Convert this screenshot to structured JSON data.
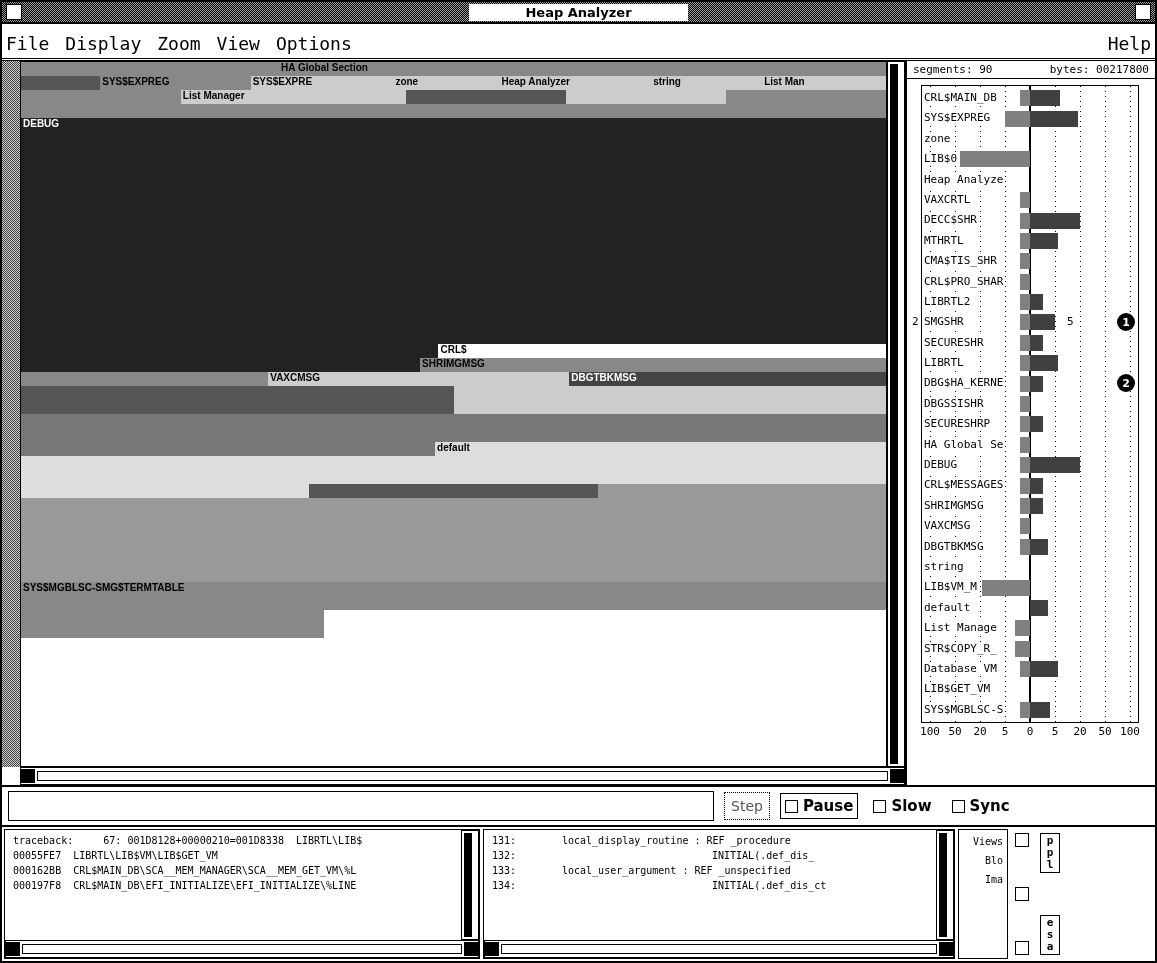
{
  "window": {
    "title": "Heap Analyzer"
  },
  "menu": {
    "items": [
      "File",
      "Display",
      "Zoom",
      "View",
      "Options"
    ],
    "help": "Help"
  },
  "memory_map": {
    "rows": [
      {
        "kind": "strip",
        "segments": [
          {
            "color": "#888888"
          },
          {
            "color": "#888888",
            "label": "HA Global Section"
          },
          {
            "color": "#888888"
          }
        ]
      },
      {
        "kind": "strip",
        "segments": [
          {
            "color": "#555555"
          },
          {
            "color": "#888888",
            "label": "SYS$EXPREG"
          },
          {
            "color": "#cccccc",
            "label": "SYS$EXPRE"
          },
          {
            "color": "#cccccc",
            "label": "zone"
          },
          {
            "color": "#cccccc",
            "label": "Heap Analyzer"
          },
          {
            "color": "#cccccc",
            "label": "string"
          },
          {
            "color": "#cccccc",
            "label": "List Man"
          }
        ]
      },
      {
        "kind": "strip",
        "segments": [
          {
            "color": "#888888"
          },
          {
            "color": "#cccccc",
            "label": "List Manager"
          },
          {
            "color": "#555555"
          },
          {
            "color": "#cccccc"
          },
          {
            "color": "#888888"
          }
        ]
      },
      {
        "kind": "strip",
        "segments": [
          {
            "color": "#888888"
          }
        ]
      },
      {
        "kind": "tall",
        "segments": [
          {
            "color": "#222222",
            "label": "DEBUG"
          }
        ]
      },
      {
        "kind": "strip",
        "segments": [
          {
            "color": "#222222"
          },
          {
            "color": "#ffffff",
            "label": "CRL$"
          }
        ]
      },
      {
        "kind": "strip",
        "segments": [
          {
            "color": "#222222"
          },
          {
            "color": "#888888",
            "label": "SHRIMGMSG"
          }
        ]
      },
      {
        "kind": "strip",
        "segments": [
          {
            "color": "#888888"
          },
          {
            "color": "#cccccc",
            "label": "VAXCMSG"
          },
          {
            "color": "#444444",
            "label": "DBGTBKMSG"
          }
        ]
      },
      {
        "kind": "band",
        "segments": [
          {
            "color": "#555555"
          },
          {
            "color": "#cccccc"
          }
        ]
      },
      {
        "kind": "band",
        "segments": [
          {
            "color": "#777777"
          }
        ]
      },
      {
        "kind": "strip",
        "segments": [
          {
            "color": "#777777"
          },
          {
            "color": "#dddddd",
            "label": "default"
          }
        ]
      },
      {
        "kind": "band",
        "segments": [
          {
            "color": "#dddddd"
          }
        ]
      },
      {
        "kind": "strip",
        "segments": [
          {
            "color": "#dddddd"
          },
          {
            "color": "#555555"
          },
          {
            "color": "#999999"
          }
        ]
      },
      {
        "kind": "block",
        "segments": [
          {
            "color": "#999999"
          }
        ]
      },
      {
        "kind": "band",
        "segments": [
          {
            "color": "#888888",
            "label": "SYS$MGBLSC-SMG$TERMTABLE"
          }
        ]
      },
      {
        "kind": "short",
        "segments": [
          {
            "color": "#888888"
          }
        ]
      }
    ]
  },
  "histogram": {
    "segments": "segments: 90",
    "bytes": "bytes: 00217800",
    "rows": [
      {
        "name": "CRL$MAIN_DB"
      },
      {
        "name": "SYS$EXPREG"
      },
      {
        "name": "zone"
      },
      {
        "name": "LIB$0"
      },
      {
        "name": "Heap Analyze"
      },
      {
        "name": "VAXCRTL"
      },
      {
        "name": "DECC$SHR"
      },
      {
        "name": "MTHRTL"
      },
      {
        "name": "CMA$TIS_SHR"
      },
      {
        "name": "CRL$PRO_SHAR"
      },
      {
        "name": "LIBRTL2"
      },
      {
        "name": "SMGSHR",
        "left_note": "2",
        "right_note": "5",
        "callout": "1"
      },
      {
        "name": "SECURESHR"
      },
      {
        "name": "LIBRTL"
      },
      {
        "name": "DBG$HA_KERNE",
        "callout": "2"
      },
      {
        "name": "DBGSSISHR"
      },
      {
        "name": "SECURESHRP"
      },
      {
        "name": "HA Global Se"
      },
      {
        "name": "DEBUG"
      },
      {
        "name": "CRL$MESSAGES"
      },
      {
        "name": "SHRIMGMSG"
      },
      {
        "name": "VAXCMSG"
      },
      {
        "name": "DBGTBKMSG"
      },
      {
        "name": "string"
      },
      {
        "name": "LIB$VM_M"
      },
      {
        "name": "default"
      },
      {
        "name": "List Manage"
      },
      {
        "name": "STR$COPY_R_"
      },
      {
        "name": "Database VM"
      },
      {
        "name": "LIB$GET_VM"
      },
      {
        "name": "SYS$MGBLSC-S"
      }
    ],
    "axis_labels": [
      "100",
      "50",
      "20",
      "5",
      "0",
      "5",
      "20",
      "50",
      "100"
    ]
  },
  "controls": {
    "step": {
      "label": "Step",
      "disabled": true
    },
    "toggles": [
      {
        "label": "Pause",
        "checked": false,
        "boxed": true
      },
      {
        "label": "Slow",
        "checked": false,
        "boxed": false
      },
      {
        "label": "Sync",
        "checked": false,
        "boxed": false
      }
    ]
  },
  "traceback": {
    "lines": [
      "traceback:     67: 001D8128+00000210=001D8338  LIBRTL\\LIB$",
      "00055FE7  LIBRTL\\LIB$VM\\LIB$GET_VM",
      "000162BB  CRL$MAIN_DB\\SCA__MEM_MANAGER\\SCA__MEM_GET_VM\\%L",
      "000197F8  CRL$MAIN_DB\\EFI_INITIALIZE\\EFI_INITIALIZE\\%LINE"
    ]
  },
  "source": {
    "lines": [
      {
        "number": "131:",
        "text": "local_display_routine : REF _procedure",
        "indent": false
      },
      {
        "number": "132:",
        "text": "INITIAL(.def_dis_",
        "indent": true
      },
      {
        "number": "133:",
        "text": "local_user_argument : REF _unspecified",
        "indent": false
      },
      {
        "number": "134:",
        "text": "INITIAL(.def_dis_ct",
        "indent": true
      }
    ]
  },
  "views": {
    "labels": [
      "Views",
      "Blo",
      "Ima"
    ],
    "buttons": [
      "ppl",
      "esa"
    ]
  }
}
